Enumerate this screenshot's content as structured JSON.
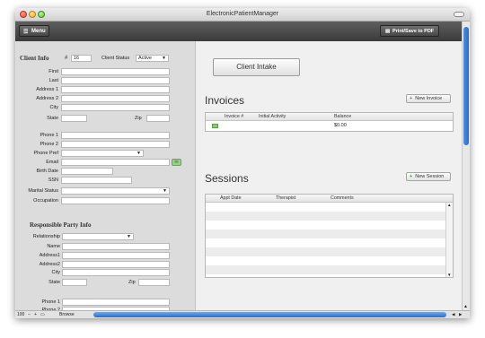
{
  "window": {
    "title": "ElectronicPatientManager"
  },
  "toolbar": {
    "menu_label": "Menu",
    "menu_icon": "list-icon",
    "print_label": "Print/Save to PDF",
    "print_icon": "printer-icon"
  },
  "client": {
    "header": "Client Info",
    "id_label": "#",
    "id_value": "16",
    "status_label": "Client Status",
    "status_value": "Active",
    "fields": {
      "first": "First",
      "last": "Last",
      "address1": "Address 1",
      "address2": "Address 2",
      "city": "City",
      "state": "State",
      "zip": "Zip",
      "phone1": "Phone 1",
      "phone2": "Phone 2",
      "phone_pref": "Phone Pref",
      "email": "Email",
      "birth_date": "Birth Date",
      "ssn": "SSN",
      "marital_status": "Marital Status",
      "occupation": "Occupation"
    }
  },
  "responsible": {
    "header": "Responsible Party Info",
    "fields": {
      "relationship": "Relationship",
      "name": "Name",
      "address1": "Address1",
      "address2": "Address2",
      "city": "City",
      "state": "State",
      "zip": "Zip",
      "phone1": "Phone 1",
      "phone2": "Phone 2"
    }
  },
  "intake": {
    "label": "Client Intake"
  },
  "invoices": {
    "title": "Invoices",
    "new_label": "New Invoice",
    "columns": [
      "Invoice #",
      "Initial Activity",
      "Balance"
    ],
    "rows": [
      {
        "invoice": "",
        "initial_activity": "",
        "balance": "$0.00"
      }
    ]
  },
  "sessions": {
    "title": "Sessions",
    "new_label": "New Session",
    "columns": [
      "Appt Date",
      "Therapist",
      "Comments"
    ]
  },
  "statusbar": {
    "zoom": "100",
    "mode": "Browse"
  },
  "colors": {
    "toolbar": "#474747",
    "accent_blue": "#2d6cc4",
    "add_green": "#3b9a3b"
  }
}
